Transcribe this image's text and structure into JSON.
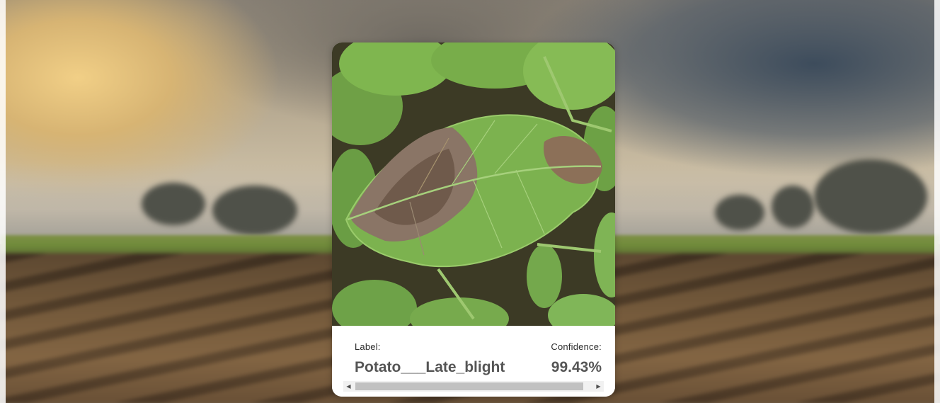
{
  "card": {
    "image_alt": "Potato leaf with late blight lesions",
    "prediction": {
      "label_caption": "Label:",
      "label_value": "Potato___Late_blight",
      "confidence_caption": "Confidence:",
      "confidence_value": "99.43%"
    },
    "scrollbar": {
      "left_arrow_icon": "triangle-left",
      "right_arrow_icon": "triangle-right",
      "left_glyph": "◀",
      "right_glyph": "▶"
    }
  }
}
